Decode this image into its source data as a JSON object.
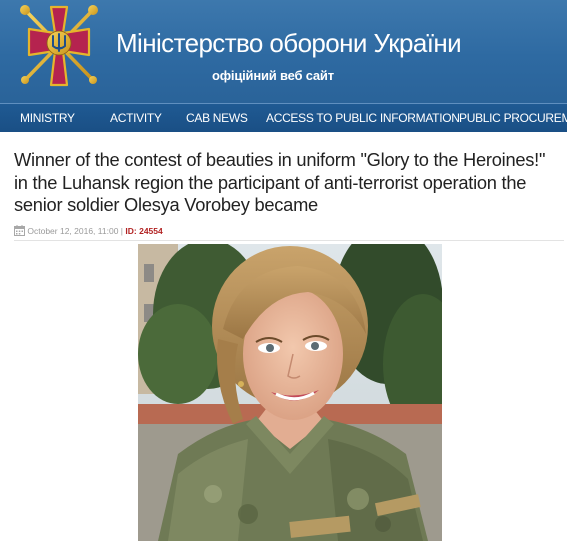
{
  "header": {
    "title": "Міністерство оборони України",
    "subtitle": "офіційний веб сайт",
    "emblem_icon": "ministry-cross-emblem-icon"
  },
  "nav": {
    "items": [
      {
        "label": "MINISTRY"
      },
      {
        "label": "ACTIVITY"
      },
      {
        "label": "CAB NEWS"
      },
      {
        "label": "ACCESS TO PUBLIC INFORMATION"
      },
      {
        "label": "PUBLIC PROCUREMENT"
      }
    ]
  },
  "article": {
    "title": "Winner of the contest of beauties in uniform \"Glory to the Heroines!\" in the Luhansk region the participant of anti-terrorist operation the senior soldier Olesya Vorobey became",
    "date": "October 12, 2016, 11:00 |",
    "id_label": "ID:",
    "id_value": "24554",
    "photo_icon": "portrait-photo"
  },
  "colors": {
    "header_blue": "#2e6aa2",
    "nav_blue": "#1c5389",
    "id_red": "#b22222",
    "emblem_magenta": "#b5234f",
    "emblem_gold": "#e5b52c"
  }
}
